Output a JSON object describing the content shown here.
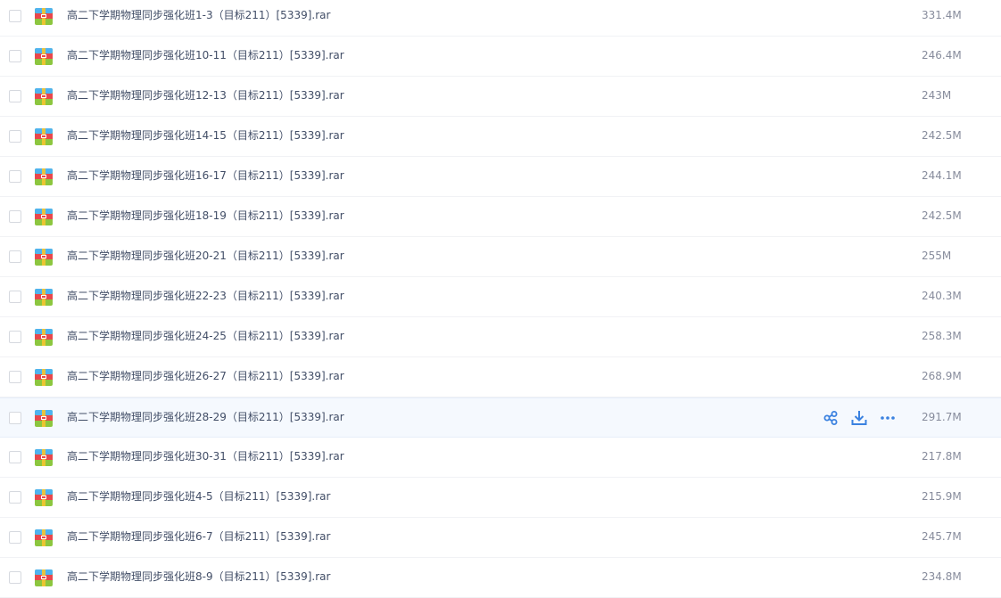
{
  "colors": {
    "accent": "#3b82e0",
    "row_hover_bg": "#f5f9fe",
    "file_name_text": "#424e67",
    "size_text": "#878c9c"
  },
  "icons": {
    "file_type": "rar-archive-icon",
    "share": "share-icon",
    "download": "download-icon",
    "more": "more-dots-icon"
  },
  "hovered_row_index": 10,
  "files": [
    {
      "name": "高二下学期物理同步强化班1-3（目标211）[5339].rar",
      "size": "331.4M"
    },
    {
      "name": "高二下学期物理同步强化班10-11（目标211）[5339].rar",
      "size": "246.4M"
    },
    {
      "name": "高二下学期物理同步强化班12-13（目标211）[5339].rar",
      "size": "243M"
    },
    {
      "name": "高二下学期物理同步强化班14-15（目标211）[5339].rar",
      "size": "242.5M"
    },
    {
      "name": "高二下学期物理同步强化班16-17（目标211）[5339].rar",
      "size": "244.1M"
    },
    {
      "name": "高二下学期物理同步强化班18-19（目标211）[5339].rar",
      "size": "242.5M"
    },
    {
      "name": "高二下学期物理同步强化班20-21（目标211）[5339].rar",
      "size": "255M"
    },
    {
      "name": "高二下学期物理同步强化班22-23（目标211）[5339].rar",
      "size": "240.3M"
    },
    {
      "name": "高二下学期物理同步强化班24-25（目标211）[5339].rar",
      "size": "258.3M"
    },
    {
      "name": "高二下学期物理同步强化班26-27（目标211）[5339].rar",
      "size": "268.9M"
    },
    {
      "name": "高二下学期物理同步强化班28-29（目标211）[5339].rar",
      "size": "291.7M"
    },
    {
      "name": "高二下学期物理同步强化班30-31（目标211）[5339].rar",
      "size": "217.8M"
    },
    {
      "name": "高二下学期物理同步强化班4-5（目标211）[5339].rar",
      "size": "215.9M"
    },
    {
      "name": "高二下学期物理同步强化班6-7（目标211）[5339].rar",
      "size": "245.7M"
    },
    {
      "name": "高二下学期物理同步强化班8-9（目标211）[5339].rar",
      "size": "234.8M"
    }
  ]
}
